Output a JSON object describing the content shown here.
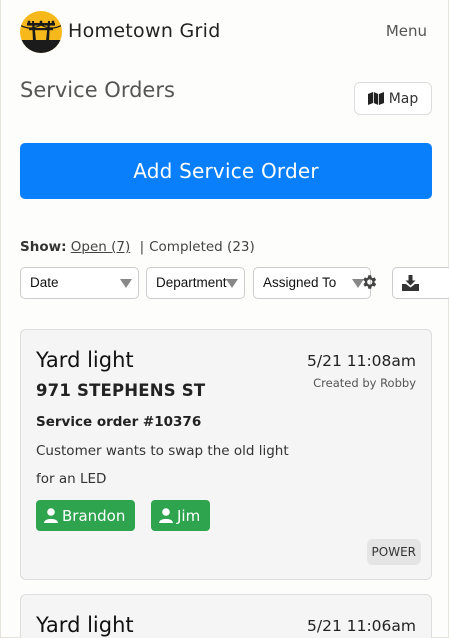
{
  "header": {
    "brand": "Hometown Grid",
    "menu_label": "Menu",
    "logo_icon": "utility-pole-logo-icon",
    "logo_color": "#f6b81b"
  },
  "page": {
    "title": "Service Orders",
    "map_button": {
      "label": "Map",
      "icon": "map-icon"
    },
    "add_button_label": "Add Service Order",
    "accent_color": "#0a7ffc"
  },
  "show": {
    "label": "Show:",
    "open_label": "Open (7)",
    "separator": "|",
    "completed_label": "Completed (23)"
  },
  "filters": {
    "date": "Date",
    "department": "Department",
    "assigned_to": "Assigned To",
    "settings_icon": "gear-icon",
    "download_icon": "download-icon"
  },
  "orders": [
    {
      "title": "Yard light",
      "time": "5/21 11:08am",
      "created_by": "Created by Robby",
      "address": "971 STEPHENS ST",
      "order_number": "Service order #10376",
      "description": "Customer wants to swap the old light for an LED",
      "assignees": [
        "Brandon",
        "Jim"
      ],
      "department": "POWER",
      "assignee_color": "#2ea44f"
    },
    {
      "title": "Yard light",
      "time": "5/21 11:06am"
    }
  ]
}
